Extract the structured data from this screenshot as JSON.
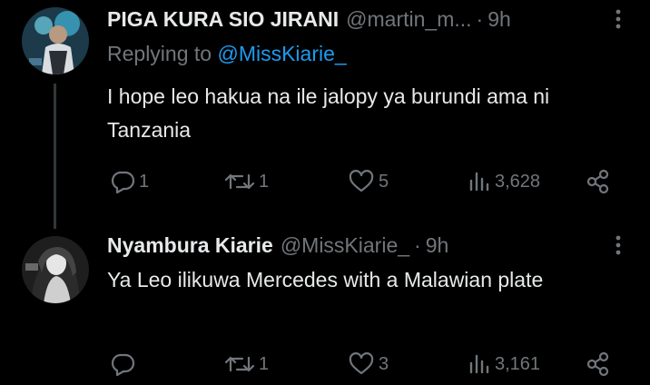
{
  "tweets": [
    {
      "display_name": "PIGA KURA SIO JIRANI",
      "handle": "@martin_m...",
      "separator": "·",
      "time": "9h",
      "replying_prefix": "Replying to",
      "replying_to": "@MissKiarie_",
      "text": "I hope leo hakua na ile jalopy ya burundi ama ni Tanzania",
      "replies": "1",
      "reposts": "1",
      "likes": "5",
      "views": "3,628"
    },
    {
      "display_name": "Nyambura Kiarie",
      "handle": "@MissKiarie_",
      "separator": "·",
      "time": "9h",
      "text": "Ya Leo ilikuwa Mercedes with a Malawian plate",
      "replies": "",
      "reposts": "1",
      "likes": "3",
      "views": "3,161"
    }
  ],
  "icons": {
    "reply": "reply-icon",
    "repost": "repost-icon",
    "like": "heart-icon",
    "views": "views-icon",
    "share": "share-icon",
    "more": "more-icon"
  },
  "colors": {
    "background": "#000000",
    "text": "#e7e9ea",
    "secondary": "#71767b",
    "mention": "#1d9bf0",
    "thread_line": "#333639"
  }
}
